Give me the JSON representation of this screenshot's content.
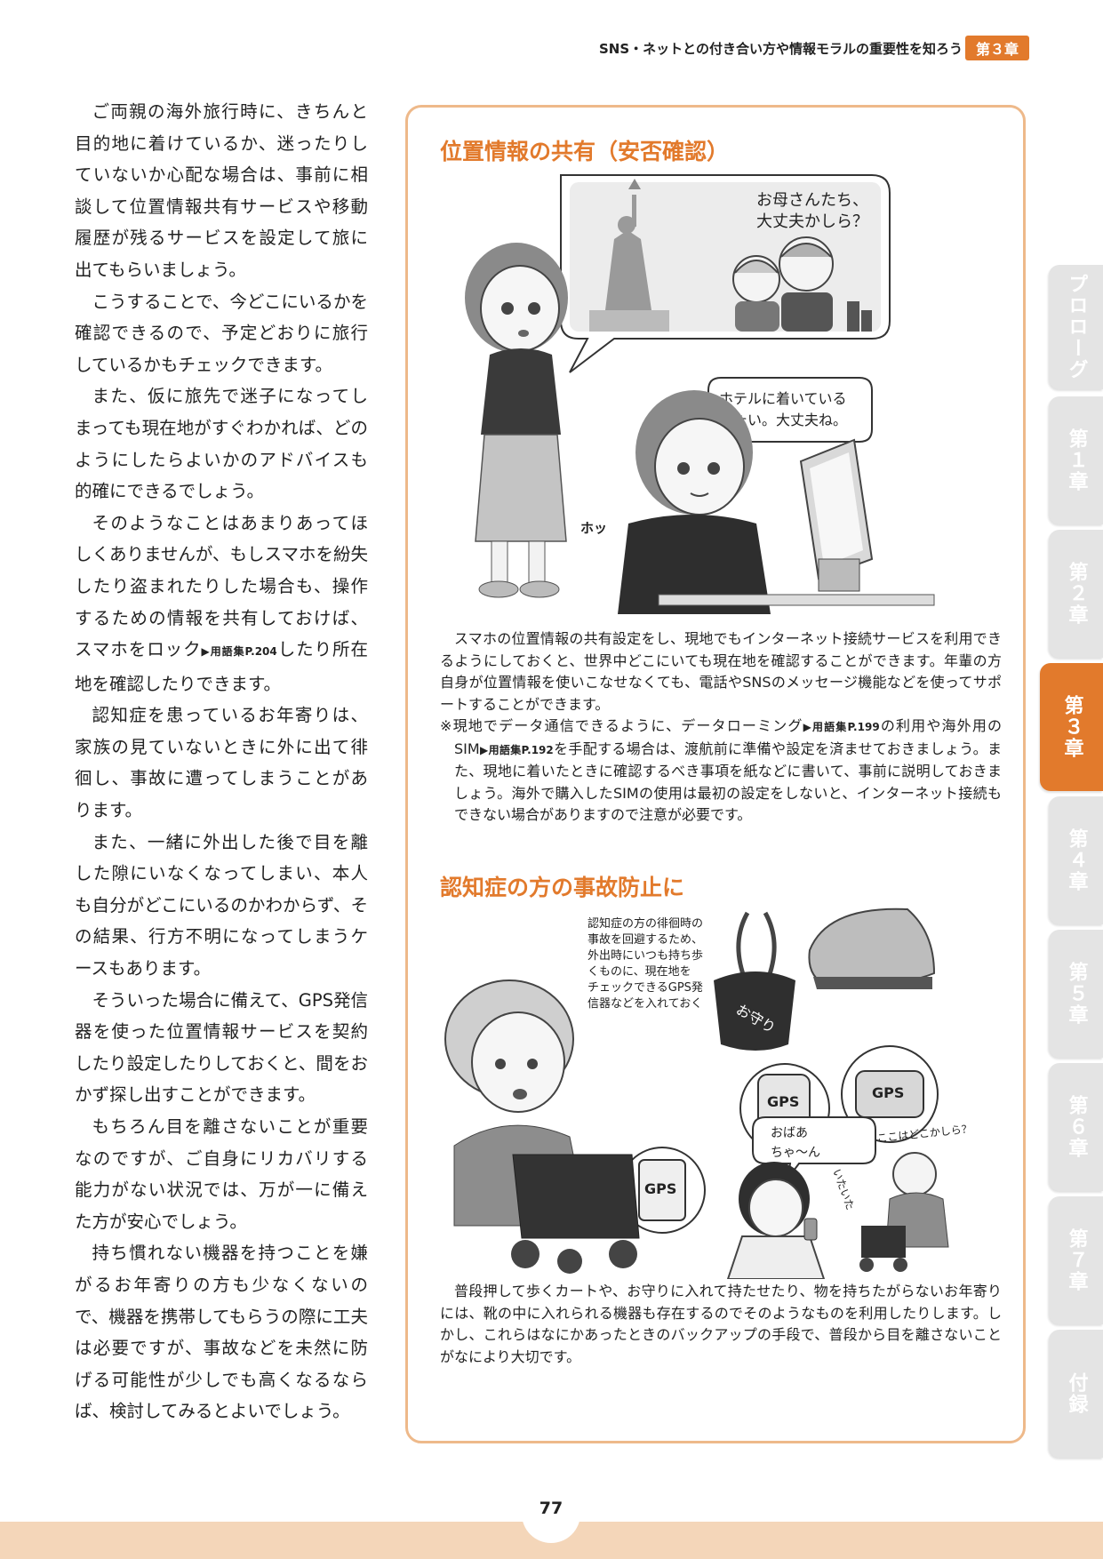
{
  "header": {
    "title": "SNS・ネットとの付き合い方や情報モラルの重要性を知ろう",
    "chapter_badge": "第３章"
  },
  "left_column": {
    "p1": "ご両親の海外旅行時に、きちんと目的地に着けているか、迷ったりしていないか心配な場合は、事前に相談して位置情報共有サービスや移動履歴が残るサービスを設定して旅に出てもらいましょう。",
    "p2": "こうすることで、今どこにいるかを確認できるので、予定どおりに旅行しているかもチェックできます。",
    "p3": "また、仮に旅先で迷子になってしまっても現在地がすぐわかれば、どのようにしたらよいかのアドバイスも的確にできるでしょう。",
    "p4_a": "そのようなことはあまりあってほしくありませんが、もしスマホを紛失したり盗まれたりした場合も、操作するための情報を共有しておけば、スマホをロック",
    "p4_ref": "▶用語集P.204",
    "p4_b": "したり所在地を確認したりできます。",
    "p5": "認知症を患っているお年寄りは、家族の見ていないときに外に出て徘徊し、事故に遭ってしまうことがあります。",
    "p6": "また、一緒に外出した後で目を離した隙にいなくなってしまい、本人も自分がどこにいるのかわからず、その結果、行方不明になってしまうケースもあります。",
    "p7": "そういった場合に備えて、GPS発信器を使った位置情報サービスを契約したり設定したりしておくと、間をおかず探し出すことができます。",
    "p8": "もちろん目を離さないことが重要なのですが、ご自身にリカバリする能力がない状況では、万が一に備えた方が安心でしょう。",
    "p9": "持ち慣れない機器を持つことを嫌がるお年寄りの方も少なくないので、機器を携帯してもらうの際に工夫は必要ですが、事故などを未然に防げる可能性が少しでも高くなるならば、検討してみるとよいでしょう。"
  },
  "section1": {
    "heading": "位置情報の共有（安否確認）",
    "bubble_top": [
      "お母さんたち、",
      "大丈夫かしら？"
    ],
    "bubble_right": [
      "ホテルに着いている",
      "みたい。大丈夫ね。"
    ],
    "sfx": "ホッ",
    "caption": "スマホの位置情報の共有設定をし、現地でもインターネット接続サービスを利用できるようにしておくと、世界中どこにいても現在地を確認することができます。年輩の方自身が位置情報を使いこなせなくても、電話やSNSのメッセージ機能などを使ってサポートすることができます。",
    "note_a": "※現地でデータ通信できるように、データローミング",
    "note_ref1": "▶用語集P.199",
    "note_b": "の利用や海外用のSIM",
    "note_ref2": "▶用語集P.192",
    "note_c": "を手配する場合は、渡航前に準備や設定を済ませておきましょう。また、現地に着いたときに確認するべき事項を紙などに書いて、事前に説明しておきましょう。海外で購入したSIMの使用は最初の設定をしないと、インターネット接続もできない場合がありますので注意が必要です。"
  },
  "section2": {
    "heading": "認知症の方の事故防止に",
    "annotation": [
      "認知症の方の徘徊時の",
      "事故を回避するため、",
      "外出時にいつも持ち歩",
      "くものに、現在地を",
      "チェックできるGPS発",
      "信器などを入れておく"
    ],
    "omamori": "お守り",
    "gps_label": "GPS",
    "bubble_child": [
      "おばあ",
      "ちゃ〜ん"
    ],
    "sfx_found": "いたいた",
    "thought": "ここはどこかしら？",
    "caption": "普段押して歩くカートや、お守りに入れて持たせたり、物を持ちたがらないお年寄りには、靴の中に入れられる機器も存在するのでそのようなものを利用したりします。しかし、これらはなにかあったときのバックアップの手段で、普段から目を離さないことがなにより大切です。"
  },
  "side_tabs": [
    "プロローグ",
    "第１章",
    "第２章",
    "第３章",
    "第４章",
    "第５章",
    "第６章",
    "第７章",
    "付録"
  ],
  "active_tab": "第３章",
  "page_number": "77",
  "colors": {
    "accent": "#e27a2c",
    "panel_border": "#eeb98a",
    "footer": "#f4d6b9",
    "tab": "#e4e4e4"
  }
}
